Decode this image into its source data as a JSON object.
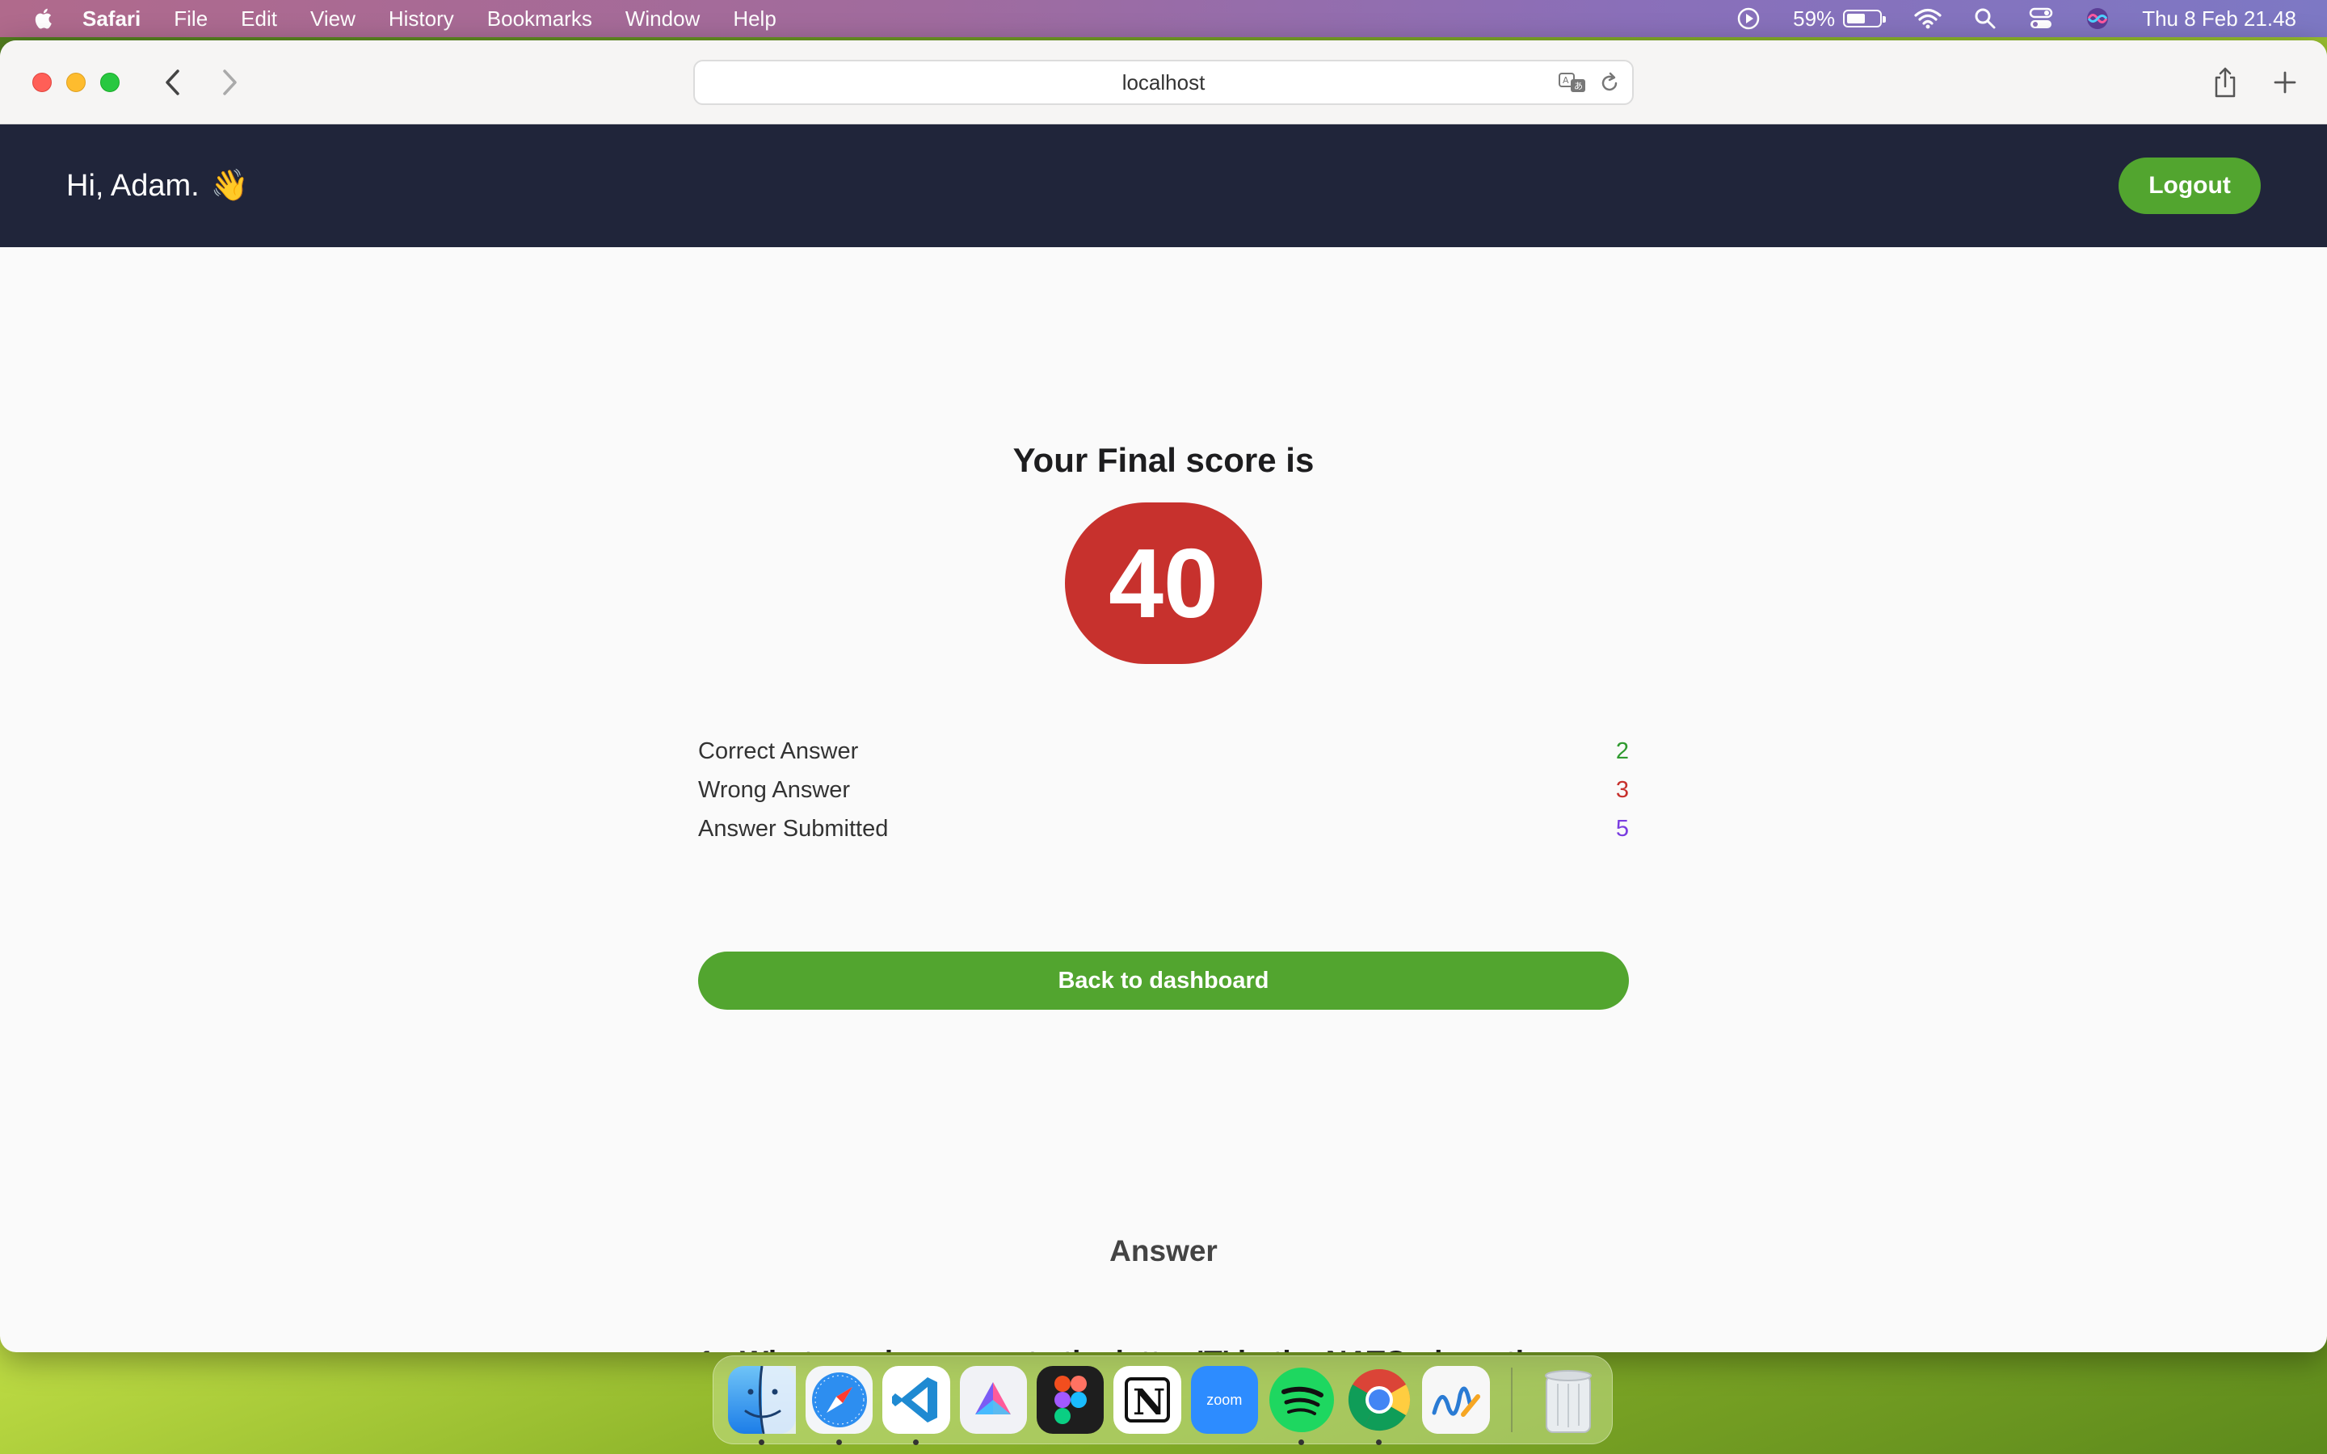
{
  "menubar": {
    "app_name": "Safari",
    "items": [
      "File",
      "Edit",
      "View",
      "History",
      "Bookmarks",
      "Window",
      "Help"
    ],
    "battery_percent": "59%",
    "battery_level": 0.59,
    "clock": "Thu 8 Feb  21.48"
  },
  "browser": {
    "url": "localhost"
  },
  "header": {
    "greeting": "Hi,  Adam.",
    "wave_emoji": "👋",
    "logout_label": "Logout"
  },
  "result": {
    "title": "Your Final score is",
    "score": "40",
    "stats": [
      {
        "label": "Correct Answer",
        "value": "2",
        "color": "#2f9a2f"
      },
      {
        "label": "Wrong Answer",
        "value": "3",
        "color": "#c7312d"
      },
      {
        "label": "Answer Submitted",
        "value": "5",
        "color": "#7a3de0"
      }
    ],
    "back_label": "Back to dashboard"
  },
  "answers": {
    "heading": "Answer",
    "questions": [
      {
        "number": "1.",
        "text": "What word represents the letter 'T' in the NATO phonetic alphabet?"
      }
    ]
  },
  "dock": {
    "apps": [
      "finder-icon",
      "safari-icon",
      "vscode-icon",
      "craft-icon",
      "figma-icon",
      "notion-icon",
      "zoom-icon",
      "spotify-icon",
      "chrome-icon",
      "freeform-icon",
      "trash-icon"
    ],
    "zoom_label": "zoom"
  },
  "colors": {
    "header_bg": "#20253a",
    "accent_green": "#52a52f",
    "score_red": "#c7312d"
  }
}
